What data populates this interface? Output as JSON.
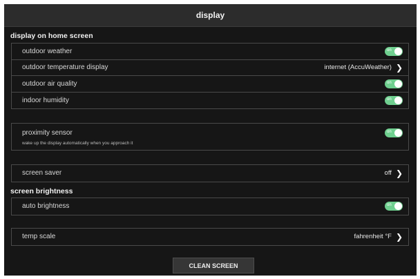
{
  "header": {
    "title": "display"
  },
  "home_screen": {
    "section_label": "display on home screen",
    "rows": [
      {
        "label": "outdoor weather",
        "toggle": "on"
      },
      {
        "label": "outdoor temperature display",
        "value": "internet (AccuWeather)"
      },
      {
        "label": "outdoor air quality",
        "toggle": "on"
      },
      {
        "label": "indoor humidity",
        "toggle": "on"
      }
    ]
  },
  "proximity": {
    "label": "proximity sensor",
    "description": "wake up the display automatically when you approach it",
    "toggle": "on"
  },
  "screen_saver": {
    "label": "screen saver",
    "value": "off"
  },
  "brightness": {
    "section_label": "screen brightness",
    "auto_label": "auto brightness",
    "toggle": "on"
  },
  "temp_scale": {
    "label": "temp scale",
    "value": "fahrenheit °F"
  },
  "footer": {
    "clean_button": "CLEAN SCREEN"
  },
  "colors": {
    "toggle_on": "#6fcf8f",
    "background": "#161616"
  }
}
